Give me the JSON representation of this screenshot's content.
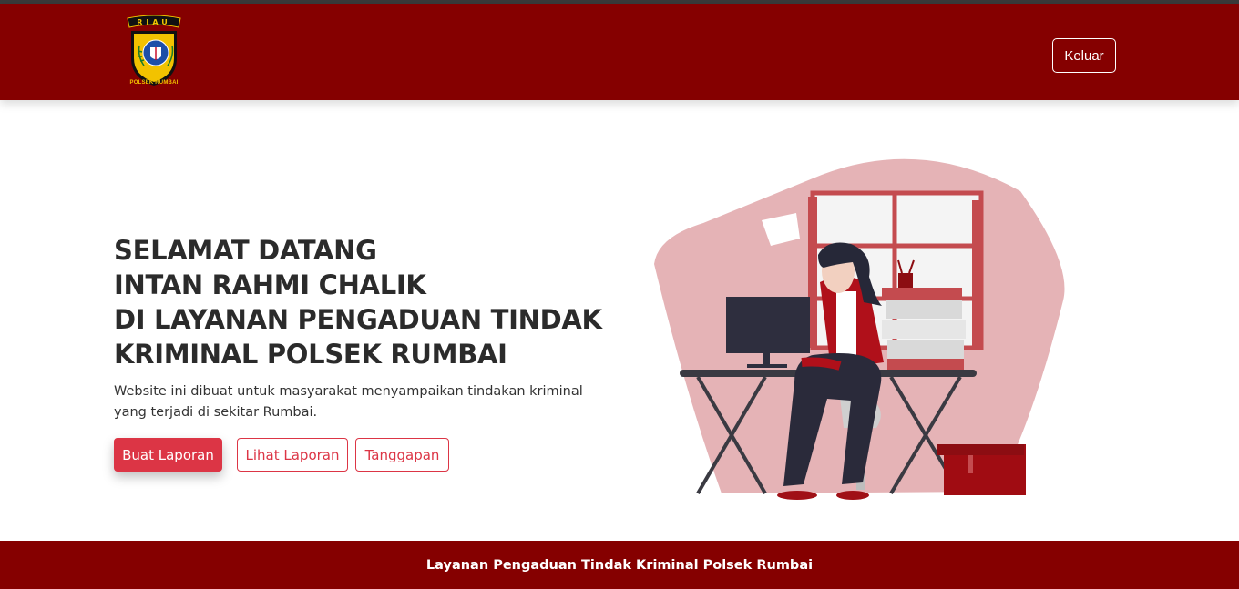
{
  "navbar": {
    "logo_top_text": "RIAU",
    "logo_bottom_text": "POLSEK RUMBAI",
    "logout_label": "Keluar"
  },
  "hero": {
    "greeting": "SELAMAT DATANG",
    "user_name": "INTAN RAHMI CHALIK",
    "line3": "DI LAYANAN PENGADUAN TINDAK",
    "line4": "KRIMINAL POLSEK RUMBAI",
    "description": "Website ini dibuat untuk masyarakat menyampaikan tindakan kriminal yang terjadi di sekitar Rumbai.",
    "buttons": {
      "create_report": "Buat Laporan",
      "view_report": "Lihat Laporan",
      "responses": "Tanggapan"
    },
    "illustration": "woman-working-at-desk-illustration"
  },
  "footer": {
    "text": "Layanan Pengaduan Tindak Kriminal Polsek Rumbai"
  },
  "colors": {
    "brand": "#850000",
    "accent": "#dc3545",
    "illustration_bg": "#e5b3b6"
  }
}
